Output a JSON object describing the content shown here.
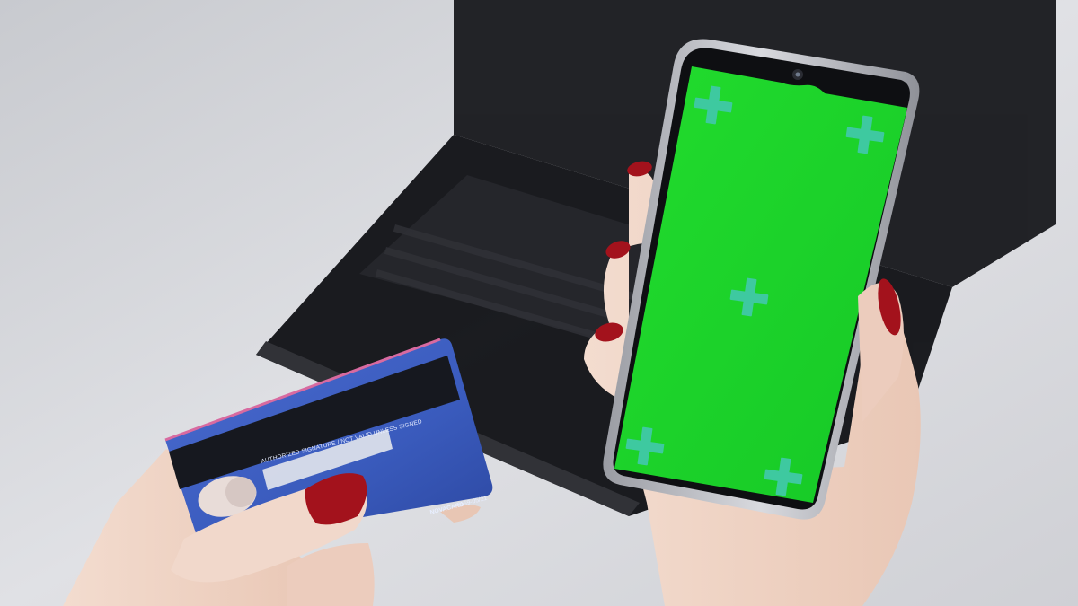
{
  "scene": {
    "description_tag": "photo",
    "colors": {
      "background": "#dcdde1",
      "laptop": "#141518",
      "card_blue": "#3d5fbf",
      "magnetic_stripe": "#16181f",
      "chroma_green": "#19d628",
      "tracking_marker": "#3ec9a0",
      "nail_polish": "#a3121c",
      "skin": "#f0d6c8"
    }
  },
  "card": {
    "signature_label": "AUTHORIZED SIGNATURE / NOT VALID UNLESS SIGNED",
    "brand": "NOVACARD",
    "serial": "5159-05/21"
  },
  "phone": {
    "screen": "green-screen",
    "markers": [
      "cross-marker",
      "cross-marker",
      "cross-marker",
      "cross-marker",
      "cross-marker"
    ]
  }
}
